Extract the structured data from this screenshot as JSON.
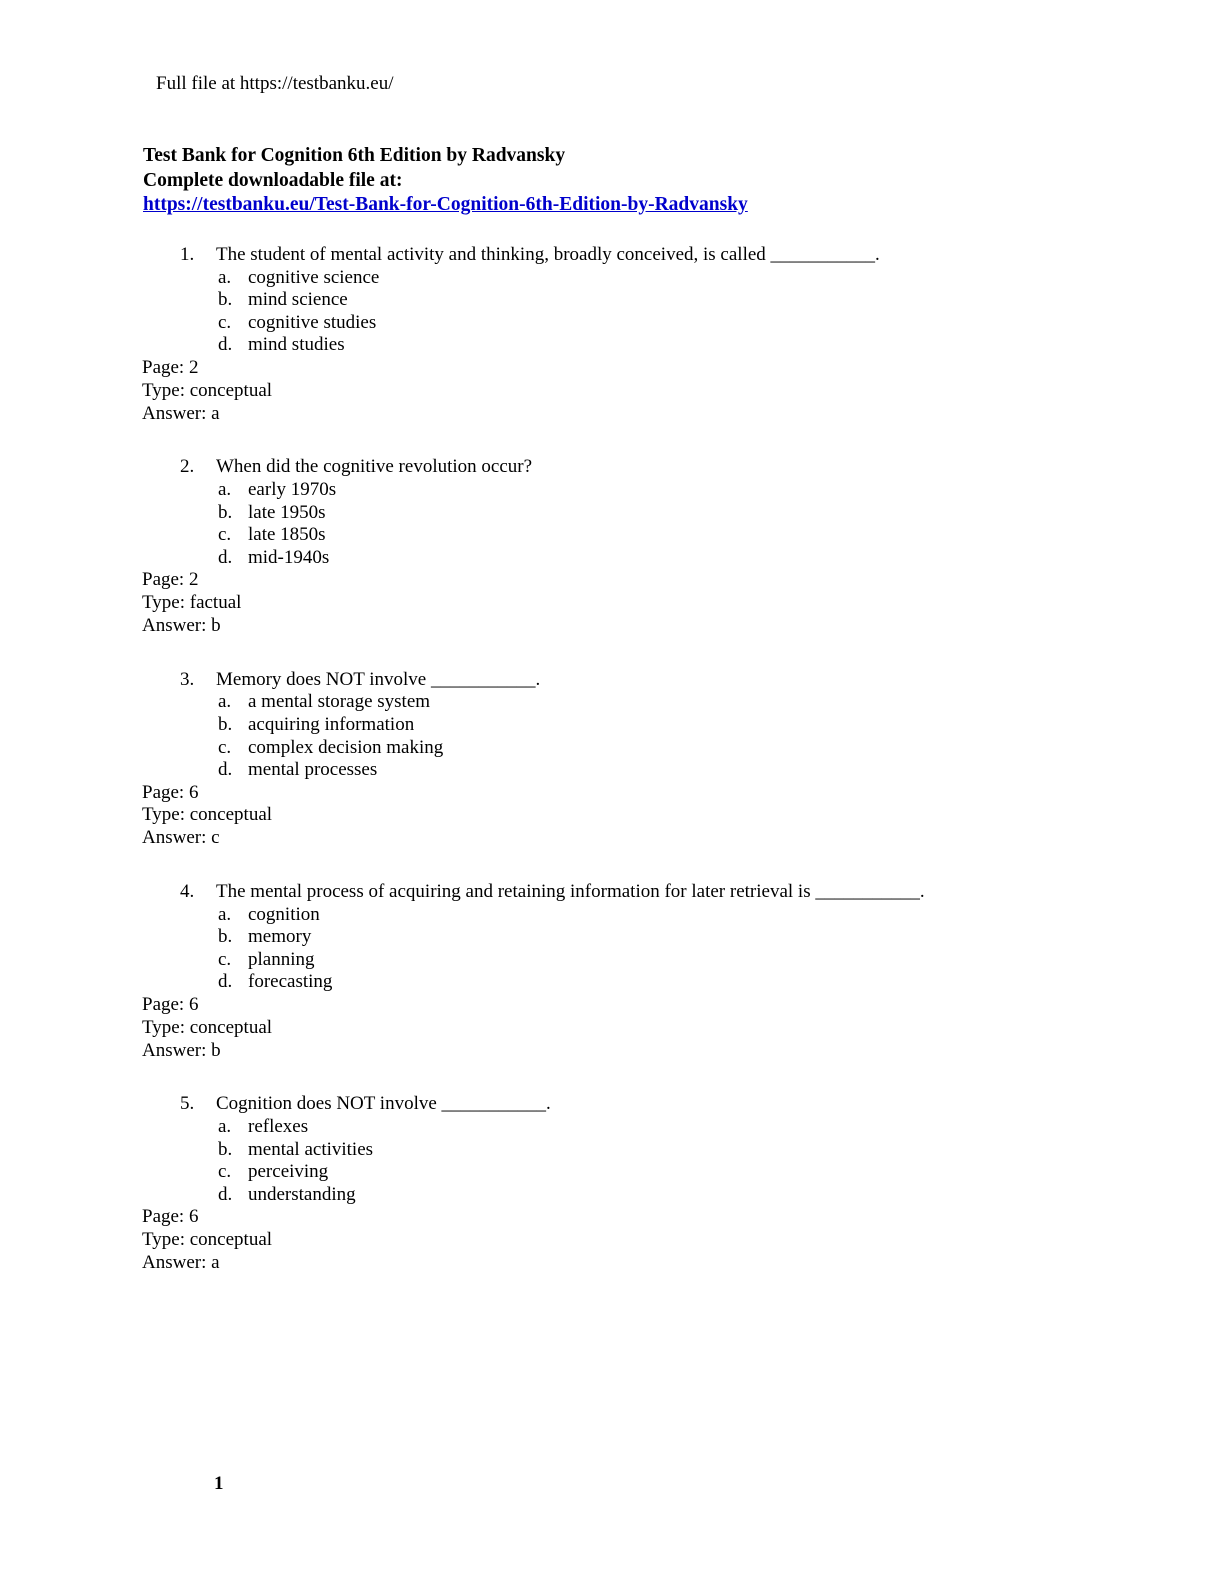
{
  "document": {
    "running_header": "Full file at https://testbanku.eu/",
    "title": "Test Bank for Cognition 6th Edition by Radvansky",
    "subtitle": "Complete downloadable file at:",
    "download_link_text": "https://testbanku.eu/Test-Bank-for-Cognition-6th-Edition-by-Radvansky ",
    "link_color": "#0000CC",
    "page_number": "1",
    "background_color": "#FFFFFF",
    "text_color": "#000000"
  },
  "labels": {
    "page_prefix": "Page:",
    "type_prefix": "Type:",
    "answer_prefix": "Answer:"
  },
  "questions": [
    {
      "number": "1.",
      "text": "The student of mental activity and thinking, broadly conceived, is called ___________.",
      "options": [
        {
          "letter": "a.",
          "text": "cognitive science"
        },
        {
          "letter": "b.",
          "text": "mind science"
        },
        {
          "letter": "c.",
          "text": "cognitive studies"
        },
        {
          "letter": "d.",
          "text": "mind studies"
        }
      ],
      "page": "Page: 2",
      "type": "Type: conceptual",
      "answer": "Answer: a"
    },
    {
      "number": "2.",
      "text": "When did the cognitive revolution occur?",
      "options": [
        {
          "letter": "a.",
          "text": "early 1970s"
        },
        {
          "letter": "b.",
          "text": "late 1950s"
        },
        {
          "letter": "c.",
          "text": "late 1850s"
        },
        {
          "letter": "d.",
          "text": "mid-1940s"
        }
      ],
      "page": "Page: 2",
      "type": "Type: factual",
      "answer": "Answer: b"
    },
    {
      "number": "3.",
      "text": "Memory does NOT involve ___________.",
      "options": [
        {
          "letter": "a.",
          "text": "a mental storage system"
        },
        {
          "letter": "b.",
          "text": "acquiring information"
        },
        {
          "letter": "c.",
          "text": "complex decision making"
        },
        {
          "letter": "d.",
          "text": "mental processes"
        }
      ],
      "page": "Page: 6",
      "type": "Type: conceptual",
      "answer": "Answer: c"
    },
    {
      "number": "4.",
      "text": "The mental process of acquiring and retaining information for later retrieval is ___________.",
      "options": [
        {
          "letter": "a.",
          "text": "cognition"
        },
        {
          "letter": "b.",
          "text": "memory"
        },
        {
          "letter": "c.",
          "text": "planning"
        },
        {
          "letter": "d.",
          "text": "forecasting"
        }
      ],
      "page": "Page: 6",
      "type": "Type: conceptual",
      "answer": "Answer: b"
    },
    {
      "number": "5.",
      "text": "Cognition does NOT involve ___________.",
      "options": [
        {
          "letter": "a.",
          "text": "reflexes"
        },
        {
          "letter": "b.",
          "text": "mental activities"
        },
        {
          "letter": "c.",
          "text": "perceiving"
        },
        {
          "letter": "d.",
          "text": "understanding"
        }
      ],
      "page": "Page: 6",
      "type": "Type: conceptual",
      "answer": "Answer: a"
    }
  ]
}
